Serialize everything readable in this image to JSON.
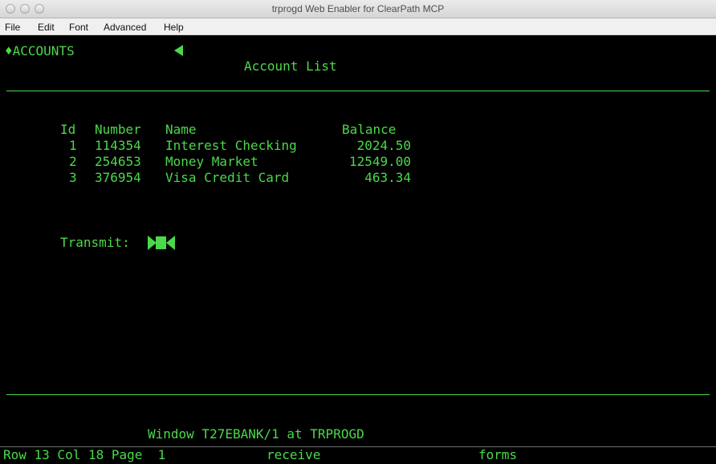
{
  "window": {
    "title": "trprogd Web Enabler for ClearPath MCP"
  },
  "menu": {
    "items": [
      "File",
      "Edit",
      "Font",
      "Advanced",
      "Help"
    ]
  },
  "screen": {
    "header_field": "♦ACCOUNTS",
    "heading": "Account List",
    "columns": [
      "Id",
      "Number",
      "Name",
      "Balance"
    ],
    "rows": [
      {
        "id": "1",
        "number": "114354",
        "name": "Interest Checking",
        "balance": "2024.50"
      },
      {
        "id": "2",
        "number": "254653",
        "name": "Money Market",
        "balance": "12549.00"
      },
      {
        "id": "3",
        "number": "376954",
        "name": "Visa Credit Card",
        "balance": "463.34"
      }
    ],
    "transmit_label": "Transmit:",
    "window_line": "Window T27EBANK/1 at TRPROGD"
  },
  "status": {
    "position": "Row 13 Col 18 Page  1",
    "mode": "receive",
    "type": "forms"
  },
  "colors": {
    "terminal_text": "#4bd84b",
    "terminal_bg": "#000000"
  }
}
